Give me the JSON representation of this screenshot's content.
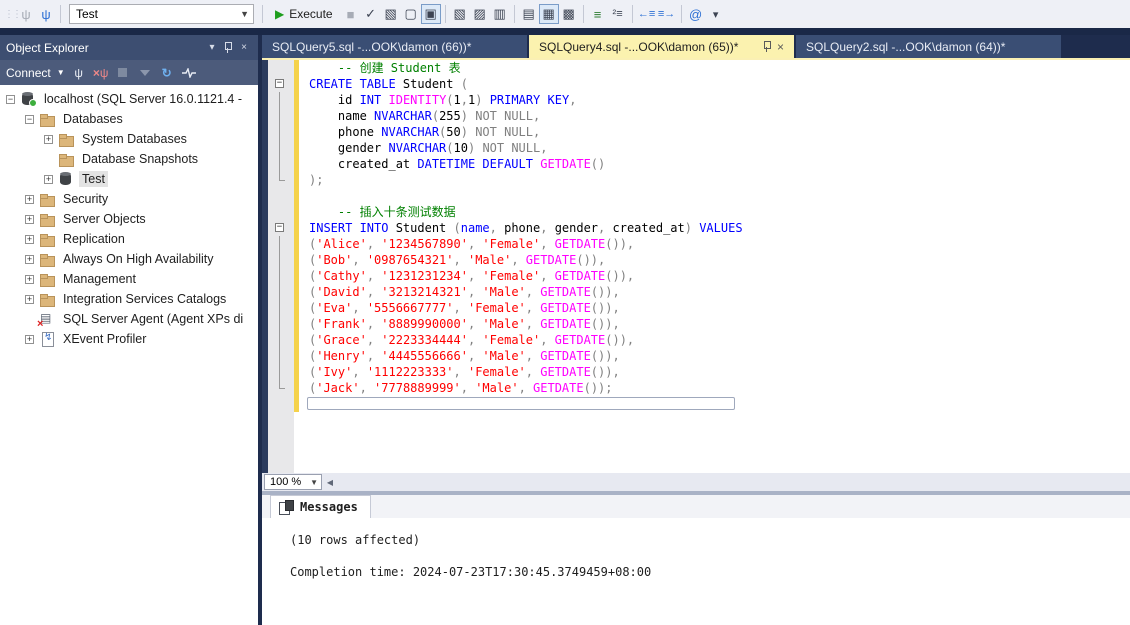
{
  "toolbar": {
    "database_selector_value": "Test",
    "execute_label": "Execute",
    "icons": [
      "connect-icon",
      "change-connection-icon",
      "execute-button",
      "stop-icon",
      "parse-icon",
      "showplan-icon",
      "query-options-icon",
      "intellisense-enabled-icon",
      "estimated-plan-icon",
      "live-query-stats-icon",
      "client-statistics-icon",
      "results-to-text-icon",
      "results-to-grid-icon",
      "results-to-file-icon",
      "comment-icon",
      "uncomment-icon",
      "decrease-indent-icon",
      "increase-indent-icon",
      "template-parameters-icon",
      "toolbar-overflow-icon"
    ]
  },
  "object_explorer": {
    "title": "Object Explorer",
    "connect_label": "Connect",
    "toolbar_icons": [
      "connect-plug-icon",
      "disconnect-plug-icon",
      "stop-icon",
      "filter-icon",
      "refresh-icon",
      "activity-monitor-icon"
    ],
    "tree": [
      {
        "label": "localhost (SQL Server 16.0.1121.4 -",
        "icon": "server",
        "expander": "minus",
        "indent": 0,
        "selected": false
      },
      {
        "label": "Databases",
        "icon": "folder",
        "expander": "minus",
        "indent": 1,
        "selected": false
      },
      {
        "label": "System Databases",
        "icon": "folder",
        "expander": "plus",
        "indent": 2,
        "selected": false
      },
      {
        "label": "Database Snapshots",
        "icon": "folder",
        "expander": "none",
        "indent": 2,
        "selected": false
      },
      {
        "label": "Test",
        "icon": "database",
        "expander": "plus",
        "indent": 2,
        "selected": true
      },
      {
        "label": "Security",
        "icon": "folder",
        "expander": "plus",
        "indent": 1,
        "selected": false
      },
      {
        "label": "Server Objects",
        "icon": "folder",
        "expander": "plus",
        "indent": 1,
        "selected": false
      },
      {
        "label": "Replication",
        "icon": "folder",
        "expander": "plus",
        "indent": 1,
        "selected": false
      },
      {
        "label": "Always On High Availability",
        "icon": "folder",
        "expander": "plus",
        "indent": 1,
        "selected": false
      },
      {
        "label": "Management",
        "icon": "folder",
        "expander": "plus",
        "indent": 1,
        "selected": false
      },
      {
        "label": "Integration Services Catalogs",
        "icon": "folder",
        "expander": "plus",
        "indent": 1,
        "selected": false
      },
      {
        "label": "SQL Server Agent (Agent XPs di",
        "icon": "agent",
        "expander": "none",
        "indent": 1,
        "selected": false
      },
      {
        "label": "XEvent Profiler",
        "icon": "xevent",
        "expander": "plus",
        "indent": 1,
        "selected": false
      }
    ]
  },
  "tabs": [
    {
      "label": "SQLQuery5.sql -...OOK\\damon (66))*",
      "active": false
    },
    {
      "label": "SQLQuery4.sql -...OOK\\damon (65))*",
      "active": true
    },
    {
      "label": "SQLQuery2.sql -...OOK\\damon (64))*",
      "active": false
    }
  ],
  "editor": {
    "zoom_level": "100 %",
    "code_lines": [
      {
        "fold": "none",
        "segs": [
          [
            "id",
            "    "
          ],
          [
            "cm",
            "-- 创建 Student 表"
          ]
        ]
      },
      {
        "fold": "open",
        "segs": [
          [
            "kw",
            "CREATE TABLE"
          ],
          [
            "id",
            " Student "
          ],
          [
            "gr",
            "("
          ]
        ]
      },
      {
        "fold": "line",
        "segs": [
          [
            "id",
            "    id "
          ],
          [
            "kw",
            "INT"
          ],
          [
            "id",
            " "
          ],
          [
            "fn",
            "IDENTITY"
          ],
          [
            "gr",
            "("
          ],
          [
            "id",
            "1"
          ],
          [
            "gr",
            ","
          ],
          [
            "id",
            "1"
          ],
          [
            "gr",
            ")"
          ],
          [
            "id",
            " "
          ],
          [
            "kw",
            "PRIMARY KEY"
          ],
          [
            "gr",
            ","
          ]
        ]
      },
      {
        "fold": "line",
        "segs": [
          [
            "id",
            "    name "
          ],
          [
            "kw",
            "NVARCHAR"
          ],
          [
            "gr",
            "("
          ],
          [
            "id",
            "255"
          ],
          [
            "gr",
            ")"
          ],
          [
            "id",
            " "
          ],
          [
            "gr",
            "NOT NULL,"
          ]
        ]
      },
      {
        "fold": "line",
        "segs": [
          [
            "id",
            "    phone "
          ],
          [
            "kw",
            "NVARCHAR"
          ],
          [
            "gr",
            "("
          ],
          [
            "id",
            "50"
          ],
          [
            "gr",
            ")"
          ],
          [
            "id",
            " "
          ],
          [
            "gr",
            "NOT NULL,"
          ]
        ]
      },
      {
        "fold": "line",
        "segs": [
          [
            "id",
            "    gender "
          ],
          [
            "kw",
            "NVARCHAR"
          ],
          [
            "gr",
            "("
          ],
          [
            "id",
            "10"
          ],
          [
            "gr",
            ")"
          ],
          [
            "id",
            " "
          ],
          [
            "gr",
            "NOT NULL,"
          ]
        ]
      },
      {
        "fold": "line",
        "segs": [
          [
            "id",
            "    created_at "
          ],
          [
            "kw",
            "DATETIME"
          ],
          [
            "id",
            " "
          ],
          [
            "kw",
            "DEFAULT"
          ],
          [
            "id",
            " "
          ],
          [
            "fn",
            "GETDATE"
          ],
          [
            "gr",
            "()"
          ]
        ]
      },
      {
        "fold": "end",
        "segs": [
          [
            "gr",
            ");"
          ]
        ]
      },
      {
        "fold": "none",
        "segs": []
      },
      {
        "fold": "none",
        "segs": [
          [
            "id",
            "    "
          ],
          [
            "cm",
            "-- 插入十条测试数据"
          ]
        ]
      },
      {
        "fold": "open",
        "segs": [
          [
            "kw",
            "INSERT INTO"
          ],
          [
            "id",
            " Student "
          ],
          [
            "gr",
            "("
          ],
          [
            "kw",
            "name"
          ],
          [
            "gr",
            ", "
          ],
          [
            "id",
            "phone"
          ],
          [
            "gr",
            ", "
          ],
          [
            "id",
            "gender"
          ],
          [
            "gr",
            ", "
          ],
          [
            "id",
            "created_at"
          ],
          [
            "gr",
            ") "
          ],
          [
            "kw",
            "VALUES"
          ]
        ]
      },
      {
        "fold": "line",
        "segs": [
          [
            "gr",
            "("
          ],
          [
            "str",
            "'Alice'"
          ],
          [
            "gr",
            ", "
          ],
          [
            "str",
            "'1234567890'"
          ],
          [
            "gr",
            ", "
          ],
          [
            "str",
            "'Female'"
          ],
          [
            "gr",
            ", "
          ],
          [
            "fn",
            "GETDATE"
          ],
          [
            "gr",
            "()),"
          ]
        ]
      },
      {
        "fold": "line",
        "segs": [
          [
            "gr",
            "("
          ],
          [
            "str",
            "'Bob'"
          ],
          [
            "gr",
            ", "
          ],
          [
            "str",
            "'0987654321'"
          ],
          [
            "gr",
            ", "
          ],
          [
            "str",
            "'Male'"
          ],
          [
            "gr",
            ", "
          ],
          [
            "fn",
            "GETDATE"
          ],
          [
            "gr",
            "()),"
          ]
        ]
      },
      {
        "fold": "line",
        "segs": [
          [
            "gr",
            "("
          ],
          [
            "str",
            "'Cathy'"
          ],
          [
            "gr",
            ", "
          ],
          [
            "str",
            "'1231231234'"
          ],
          [
            "gr",
            ", "
          ],
          [
            "str",
            "'Female'"
          ],
          [
            "gr",
            ", "
          ],
          [
            "fn",
            "GETDATE"
          ],
          [
            "gr",
            "()),"
          ]
        ]
      },
      {
        "fold": "line",
        "segs": [
          [
            "gr",
            "("
          ],
          [
            "str",
            "'David'"
          ],
          [
            "gr",
            ", "
          ],
          [
            "str",
            "'3213214321'"
          ],
          [
            "gr",
            ", "
          ],
          [
            "str",
            "'Male'"
          ],
          [
            "gr",
            ", "
          ],
          [
            "fn",
            "GETDATE"
          ],
          [
            "gr",
            "()),"
          ]
        ]
      },
      {
        "fold": "line",
        "segs": [
          [
            "gr",
            "("
          ],
          [
            "str",
            "'Eva'"
          ],
          [
            "gr",
            ", "
          ],
          [
            "str",
            "'5556667777'"
          ],
          [
            "gr",
            ", "
          ],
          [
            "str",
            "'Female'"
          ],
          [
            "gr",
            ", "
          ],
          [
            "fn",
            "GETDATE"
          ],
          [
            "gr",
            "()),"
          ]
        ]
      },
      {
        "fold": "line",
        "segs": [
          [
            "gr",
            "("
          ],
          [
            "str",
            "'Frank'"
          ],
          [
            "gr",
            ", "
          ],
          [
            "str",
            "'8889990000'"
          ],
          [
            "gr",
            ", "
          ],
          [
            "str",
            "'Male'"
          ],
          [
            "gr",
            ", "
          ],
          [
            "fn",
            "GETDATE"
          ],
          [
            "gr",
            "()),"
          ]
        ]
      },
      {
        "fold": "line",
        "segs": [
          [
            "gr",
            "("
          ],
          [
            "str",
            "'Grace'"
          ],
          [
            "gr",
            ", "
          ],
          [
            "str",
            "'2223334444'"
          ],
          [
            "gr",
            ", "
          ],
          [
            "str",
            "'Female'"
          ],
          [
            "gr",
            ", "
          ],
          [
            "fn",
            "GETDATE"
          ],
          [
            "gr",
            "()),"
          ]
        ]
      },
      {
        "fold": "line",
        "segs": [
          [
            "gr",
            "("
          ],
          [
            "str",
            "'Henry'"
          ],
          [
            "gr",
            ", "
          ],
          [
            "str",
            "'4445556666'"
          ],
          [
            "gr",
            ", "
          ],
          [
            "str",
            "'Male'"
          ],
          [
            "gr",
            ", "
          ],
          [
            "fn",
            "GETDATE"
          ],
          [
            "gr",
            "()),"
          ]
        ]
      },
      {
        "fold": "line",
        "segs": [
          [
            "gr",
            "("
          ],
          [
            "str",
            "'Ivy'"
          ],
          [
            "gr",
            ", "
          ],
          [
            "str",
            "'1112223333'"
          ],
          [
            "gr",
            ", "
          ],
          [
            "str",
            "'Female'"
          ],
          [
            "gr",
            ", "
          ],
          [
            "fn",
            "GETDATE"
          ],
          [
            "gr",
            "()),"
          ]
        ]
      },
      {
        "fold": "end",
        "segs": [
          [
            "gr",
            "("
          ],
          [
            "str",
            "'Jack'"
          ],
          [
            "gr",
            ", "
          ],
          [
            "str",
            "'7778889999'"
          ],
          [
            "gr",
            ", "
          ],
          [
            "str",
            "'Male'"
          ],
          [
            "gr",
            ", "
          ],
          [
            "fn",
            "GETDATE"
          ],
          [
            "gr",
            "());"
          ]
        ]
      },
      {
        "fold": "none",
        "caret": true,
        "segs": []
      }
    ]
  },
  "results": {
    "tab_label": "Messages",
    "lines": [
      "(10 rows affected)",
      "",
      "Completion time: 2024-07-23T17:30:45.3749459+08:00"
    ]
  },
  "colors": {
    "active_tab": "#FBF2AF",
    "change_bar_yellow": "#F5D24B",
    "keyword_blue": "#0000FF",
    "comment_green": "#008000",
    "string_red": "#FF0000",
    "function_magenta": "#FF00FF",
    "operator_gray": "#808080",
    "execute_green": "#1E9E1E",
    "dark_frame": "#1E2C4D"
  }
}
